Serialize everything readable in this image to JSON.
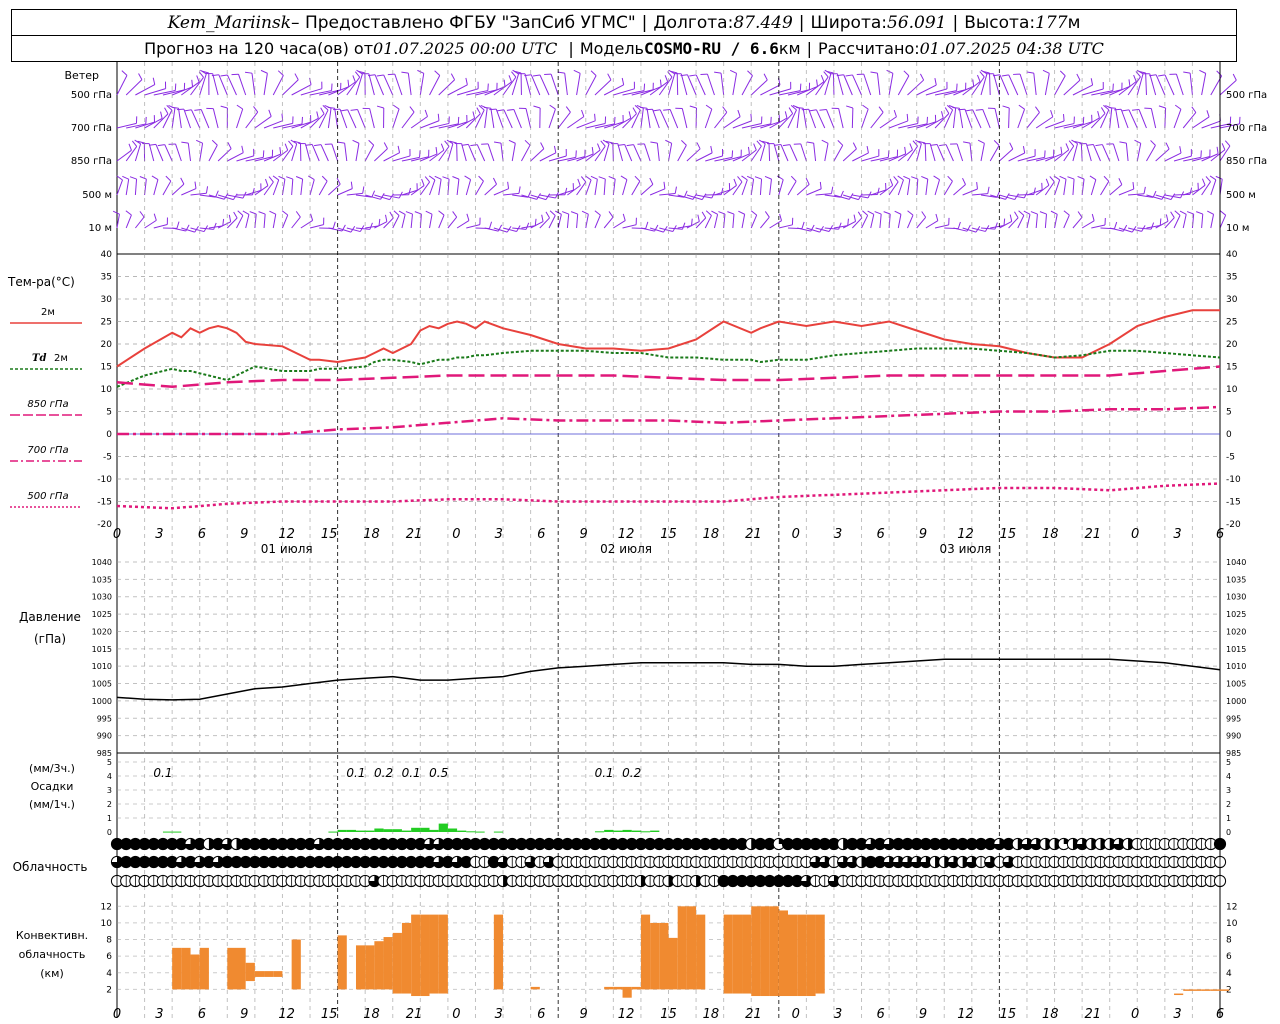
{
  "header": {
    "station": "Kem_Mariinsk",
    "provider": "– Предоставлено ФГБУ \"ЗапСиб УГМС\"",
    "lon_label": "Долгота:",
    "lon": "87.449",
    "lat_label": "Широта:",
    "lat": "56.091",
    "alt_label": "Высота:",
    "alt": "177",
    "alt_unit": "м",
    "forecast_label": "Прогноз на 120 часа(ов) от",
    "forecast_start": "01.07.2025 00:00 UTC",
    "model_label": "Модель",
    "model": "COSMO-RU / 6.6",
    "model_unit": "км",
    "calc_label": "Рассчитано:",
    "calc_time": "01.07.2025 04:38 UTC"
  },
  "wind_panel": {
    "title": "Ветер",
    "levels": [
      "500 гПа",
      "700 гПа",
      "850 гПа",
      "500 м",
      "10  м"
    ],
    "barb_color": "#8a2be2"
  },
  "x_axis": {
    "hour_ticks": [
      "0",
      "3",
      "6",
      "9",
      "12",
      "15",
      "18",
      "21",
      "0",
      "3",
      "6",
      "9",
      "12",
      "15",
      "18",
      "21",
      "0",
      "3",
      "6",
      "9",
      "12",
      "15",
      "18",
      "21",
      "0",
      "3",
      "6"
    ],
    "day_labels": [
      "01 июля",
      "02 июля",
      "03 июля"
    ]
  },
  "legend": {
    "title": "Тем-ра(°С)",
    "t2m": "2м",
    "td_prefix": "Td",
    "td": "2м",
    "t850": "850 гПа",
    "t700": "700 гПа",
    "t500": "500 гПа"
  },
  "pressure_panel": {
    "title1": "Давление",
    "title2": "(гПа)"
  },
  "precip_panel": {
    "unit1": "(мм/3ч.)",
    "title": "Осадки",
    "unit2": "(мм/1ч.)",
    "labels": [
      {
        "h": 5,
        "text": "0.1"
      },
      {
        "h": 26,
        "text": "0.1"
      },
      {
        "h": 29,
        "text": "0.2"
      },
      {
        "h": 32,
        "text": "0.1"
      },
      {
        "h": 35,
        "text": "0.5"
      },
      {
        "h": 53,
        "text": "0.1"
      },
      {
        "h": 56,
        "text": "0.2"
      }
    ]
  },
  "cloud_panel": {
    "title": "Облачность"
  },
  "conv_panel": {
    "title1": "Конвективн.",
    "title2": "облачность",
    "title3": "(км)"
  },
  "colors": {
    "t2m": "#e8413c",
    "td": "#1a7a1a",
    "t_upper": "#e0187a",
    "pressure": "#000000",
    "precip": "#22cc22",
    "conv": "#f08a30",
    "grid": "#999999",
    "zero_line": "#3333cc"
  },
  "chart_data": [
    {
      "type": "line",
      "title": "Тем-ра(°С)",
      "x_unit": "hours from 01.07.2025 00:00 UTC",
      "ylim": [
        -20,
        40
      ],
      "x": [
        0,
        3,
        6,
        7,
        8,
        9,
        10,
        11,
        12,
        13,
        14,
        15,
        18,
        21,
        22,
        24,
        27,
        28,
        29,
        30,
        32,
        33,
        34,
        35,
        36,
        37,
        38,
        39,
        40,
        42,
        45,
        48,
        51,
        54,
        57,
        60,
        63,
        66,
        69,
        70,
        72,
        75,
        78,
        81,
        84,
        87,
        90,
        93,
        96,
        99,
        102,
        105,
        108,
        111,
        114,
        117,
        120
      ],
      "series": [
        {
          "name": "2м",
          "values": [
            15,
            19,
            22.5,
            21.5,
            23.5,
            22.5,
            23.5,
            24,
            23.5,
            22.5,
            20.5,
            20,
            19.5,
            16.5,
            16.5,
            16,
            17,
            18,
            19,
            18,
            20,
            23,
            24,
            23.5,
            24.5,
            25,
            24.5,
            23.5,
            25,
            23.5,
            22,
            20,
            19,
            19,
            18.5,
            19,
            21,
            25,
            22.5,
            23.5,
            25,
            24,
            25,
            24,
            25,
            23,
            21,
            20,
            19.5,
            18,
            17,
            17,
            20,
            24,
            26,
            27.5,
            27.5
          ]
        },
        {
          "name": "2м",
          "values": [
            10.5,
            13,
            14.5,
            14,
            14,
            13.5,
            13,
            12.5,
            12,
            13,
            14,
            15,
            14,
            14,
            14.5,
            14.5,
            15,
            16,
            16.5,
            16.5,
            16,
            15.5,
            16,
            16.5,
            16.5,
            17,
            17,
            17.5,
            17.5,
            18,
            18.5,
            18.5,
            18.5,
            18,
            18,
            17,
            17,
            16.5,
            16.5,
            16,
            16.5,
            16.5,
            17.5,
            18,
            18.5,
            19,
            19,
            19,
            18.5,
            18,
            17,
            17.5,
            18.5,
            18.5,
            18,
            17.5,
            17
          ]
        }
      ]
    },
    {
      "type": "line",
      "title": "",
      "x_unit": "hours from 01.07.2025 00:00 UTC",
      "ylim": [
        -20,
        40
      ],
      "x": [
        0,
        6,
        12,
        18,
        24,
        30,
        36,
        42,
        48,
        54,
        60,
        66,
        72,
        78,
        84,
        90,
        96,
        102,
        108,
        114,
        120
      ],
      "series": [
        {
          "name": "850 гПа",
          "values": [
            11.5,
            10.5,
            11.5,
            12,
            12,
            12.5,
            13,
            13,
            13,
            13,
            12.5,
            12,
            12,
            12.5,
            13,
            13,
            13,
            13,
            13,
            14,
            15
          ]
        },
        {
          "name": "700 гПа",
          "values": [
            0,
            0,
            0,
            0,
            1,
            1.5,
            2.5,
            3.5,
            3,
            3,
            3,
            2.5,
            3,
            3.5,
            4,
            4.5,
            5,
            5,
            5.5,
            5.5,
            6
          ]
        },
        {
          "name": "500 гПа",
          "values": [
            -16,
            -16.5,
            -15.5,
            -15,
            -15,
            -15,
            -14.5,
            -14.5,
            -15,
            -15,
            -15,
            -15,
            -14,
            -13.5,
            -13,
            -12.5,
            -12,
            -12,
            -12.5,
            -11.5,
            -11
          ]
        }
      ]
    },
    {
      "type": "line",
      "title": "Давление (гПа)",
      "x_unit": "hours from 01.07.2025 00:00 UTC",
      "ylim": [
        985,
        1040
      ],
      "x": [
        0,
        3,
        6,
        9,
        12,
        15,
        18,
        21,
        24,
        27,
        30,
        33,
        36,
        39,
        42,
        45,
        48,
        51,
        54,
        57,
        60,
        63,
        66,
        69,
        72,
        75,
        78,
        81,
        84,
        87,
        90,
        93,
        96,
        99,
        102,
        105,
        108,
        111,
        114,
        117,
        120
      ],
      "series": [
        {
          "name": "",
          "values": [
            1001,
            1000.5,
            1000.3,
            1000.5,
            1002,
            1003.5,
            1004,
            1005,
            1006,
            1006.5,
            1007,
            1006,
            1006,
            1006.5,
            1007,
            1008.5,
            1009.5,
            1010,
            1010.5,
            1011,
            1011,
            1011,
            1011,
            1010.5,
            1010.5,
            1010,
            1010,
            1010.5,
            1011,
            1011.5,
            1012,
            1012,
            1012,
            1012,
            1012,
            1012,
            1012,
            1011.5,
            1011,
            1010,
            1009
          ]
        }
      ]
    },
    {
      "type": "bar",
      "title": "Осадки (мм/1ч.)",
      "x_unit": "hours from 01.07.2025 00:00 UTC",
      "ylim": [
        0,
        5
      ],
      "x": [
        5,
        6,
        23,
        24,
        25,
        26,
        27,
        28,
        29,
        30,
        31,
        32,
        33,
        34,
        35,
        36,
        37,
        38,
        39,
        41,
        52,
        53,
        54,
        55,
        56,
        57,
        58
      ],
      "values": [
        0.03,
        0.03,
        0.03,
        0.15,
        0.15,
        0.1,
        0.1,
        0.25,
        0.2,
        0.2,
        0.1,
        0.3,
        0.3,
        0.15,
        0.6,
        0.25,
        0.1,
        0.05,
        0.03,
        0.03,
        0.05,
        0.15,
        0.1,
        0.15,
        0.1,
        0.05,
        0.1
      ]
    },
    {
      "type": "heatmap",
      "title": "Облачность",
      "levels": [
        "upper",
        "middle",
        "lower"
      ],
      "x_unit": "hours from 01.07.2025 00:00 UTC",
      "x": [
        0,
        1,
        2,
        3,
        4,
        5,
        6,
        7,
        8,
        9,
        10,
        11,
        12,
        13,
        14,
        15,
        16,
        17,
        18,
        19,
        20,
        21,
        22,
        23,
        24,
        25,
        26,
        27,
        28,
        29,
        30,
        31,
        32,
        33,
        34,
        35,
        36,
        37,
        38,
        39,
        40,
        41,
        42,
        43,
        44,
        45,
        46,
        47,
        48,
        49,
        50,
        51,
        52,
        53,
        54,
        55,
        56,
        57,
        58,
        59,
        60,
        61,
        62,
        63,
        64,
        65,
        66,
        67,
        68,
        69,
        70,
        71,
        72,
        73,
        74,
        75,
        76,
        77,
        78,
        79,
        80,
        81,
        82,
        83,
        84,
        85,
        86,
        87,
        88,
        89,
        90,
        91,
        92,
        93,
        94,
        95,
        96,
        97,
        98,
        99,
        100,
        101,
        102,
        103,
        104,
        105,
        106,
        107,
        108,
        109,
        110,
        111,
        112,
        113,
        114,
        115,
        116,
        117,
        118,
        119,
        120
      ],
      "cover_octas": [
        [
          8,
          8,
          8,
          8,
          8,
          8,
          8,
          8,
          6,
          8,
          4,
          8,
          6,
          4,
          8,
          8,
          8,
          8,
          8,
          8,
          8,
          8,
          6,
          8,
          8,
          8,
          8,
          8,
          8,
          8,
          8,
          8,
          8,
          8,
          6,
          6,
          8,
          8,
          8,
          8,
          8,
          8,
          8,
          8,
          8,
          8,
          8,
          8,
          8,
          8,
          8,
          8,
          8,
          8,
          8,
          8,
          8,
          8,
          8,
          8,
          8,
          8,
          8,
          8,
          8,
          8,
          8,
          8,
          8,
          4,
          8,
          8,
          2,
          8,
          8,
          8,
          8,
          8,
          8,
          4,
          8,
          8,
          6,
          8,
          6,
          8,
          8,
          8,
          8,
          8,
          8,
          8,
          8,
          8,
          8,
          8,
          6,
          8,
          4,
          6,
          6,
          4,
          4,
          2,
          4,
          6,
          4,
          4,
          4,
          6,
          4,
          0,
          0,
          0,
          0,
          0,
          0,
          0,
          0,
          0,
          8
        ],
        [
          6,
          8,
          8,
          8,
          8,
          8,
          8,
          6,
          8,
          6,
          8,
          6,
          8,
          8,
          8,
          8,
          8,
          8,
          8,
          8,
          8,
          8,
          8,
          8,
          8,
          8,
          8,
          8,
          8,
          8,
          8,
          8,
          8,
          8,
          8,
          6,
          8,
          6,
          8,
          0,
          0,
          8,
          6,
          0,
          0,
          6,
          0,
          6,
          0,
          0,
          0,
          0,
          0,
          0,
          0,
          0,
          0,
          0,
          0,
          0,
          0,
          0,
          0,
          0,
          0,
          0,
          0,
          0,
          0,
          0,
          0,
          0,
          0,
          0,
          0,
          0,
          6,
          6,
          0,
          6,
          6,
          4,
          8,
          8,
          6,
          6,
          6,
          6,
          6,
          4,
          4,
          6,
          4,
          6,
          0,
          6,
          0,
          6,
          0,
          0,
          0,
          0,
          0,
          0,
          0,
          0,
          0,
          0,
          0,
          0,
          0,
          0,
          0,
          0,
          0,
          0,
          0,
          0,
          0,
          0,
          0
        ],
        [
          0,
          0,
          0,
          0,
          0,
          0,
          0,
          0,
          0,
          0,
          0,
          0,
          0,
          0,
          0,
          0,
          0,
          0,
          0,
          0,
          0,
          0,
          0,
          0,
          0,
          0,
          0,
          0,
          6,
          0,
          0,
          0,
          0,
          0,
          0,
          0,
          0,
          0,
          0,
          0,
          0,
          0,
          4,
          0,
          0,
          0,
          0,
          0,
          0,
          0,
          0,
          0,
          0,
          0,
          0,
          0,
          0,
          4,
          0,
          0,
          4,
          0,
          0,
          4,
          0,
          0,
          8,
          8,
          8,
          8,
          8,
          8,
          8,
          8,
          8,
          6,
          0,
          0,
          6,
          0,
          0,
          0,
          0,
          0,
          0,
          0,
          0,
          0,
          0,
          0,
          0,
          0,
          0,
          0,
          0,
          0,
          0,
          0,
          0,
          0,
          0,
          0,
          0,
          0,
          0,
          0,
          0,
          0,
          0,
          0,
          0,
          0,
          0,
          0,
          0,
          0,
          0,
          0,
          0,
          0,
          0
        ]
      ]
    },
    {
      "type": "bar",
      "title": "Конвективн. облачность (км)",
      "x_unit": "hours from 01.07.2025 00:00 UTC",
      "ylim": [
        0,
        13
      ],
      "x": [
        6,
        7,
        8,
        9,
        12,
        13,
        14,
        15,
        16,
        17,
        19,
        24,
        26,
        27,
        28,
        29,
        30,
        31,
        32,
        33,
        34,
        35,
        41,
        45,
        53,
        54,
        55,
        56,
        57,
        58,
        59,
        60,
        61,
        62,
        63,
        66,
        67,
        68,
        69,
        70,
        71,
        72,
        73,
        74,
        75,
        76,
        115,
        116,
        117,
        118,
        119,
        120
      ],
      "bottom": [
        2,
        2,
        2,
        2,
        2,
        2,
        3,
        3.5,
        3.5,
        3.5,
        2,
        2,
        2,
        2,
        2,
        2,
        1.5,
        1.5,
        1.2,
        1.2,
        1.5,
        1.5,
        2,
        2,
        2,
        2,
        1,
        2,
        2,
        2,
        2,
        2,
        2,
        2,
        2,
        1.5,
        1.5,
        1.5,
        1.2,
        1.2,
        1.2,
        1.2,
        1.2,
        1.2,
        1.2,
        1.5,
        1.5,
        2,
        2,
        2,
        2,
        2
      ],
      "top": [
        7,
        7,
        6.2,
        7,
        7,
        7,
        5.2,
        4.2,
        4.2,
        4.2,
        8,
        8.5,
        7.3,
        7.3,
        7.8,
        8.3,
        8.8,
        10,
        11,
        11,
        11,
        11,
        11,
        2.3,
        2.3,
        2.3,
        2.3,
        2.3,
        11,
        10,
        10,
        8.2,
        12,
        12,
        11,
        11,
        11,
        11,
        12,
        12,
        12,
        11.5,
        11,
        11,
        11,
        11,
        1.5,
        2,
        2,
        2,
        2,
        2
      ]
    }
  ]
}
